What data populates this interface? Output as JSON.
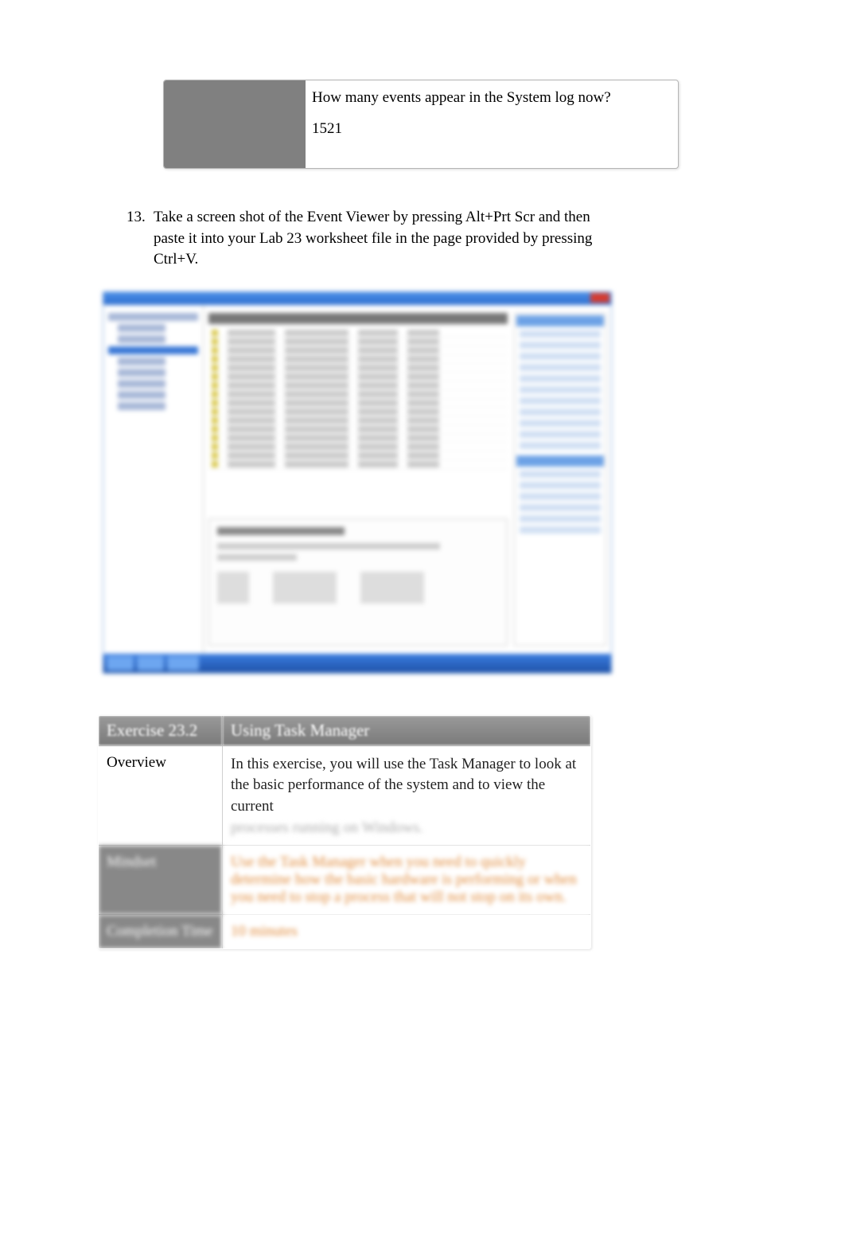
{
  "question_box": {
    "question": "How many events appear in the System log now?",
    "answer": "1521"
  },
  "step": {
    "number": "13.",
    "text_part1": "Take a screen shot of the Event Viewer by pressing ",
    "kbd1": "Alt+Prt Scr",
    "text_part2": " and then paste it into your Lab 23 worksheet file in the page provided by pressing Ctrl+V."
  },
  "exercise": {
    "header_label": "Exercise 23.2",
    "header_title": "Using Task Manager",
    "overview_label": "Overview",
    "overview_text": "In this exercise, you will use the Task Manager to look at the basic performance of the system and to view the current",
    "overview_blurred": "processes running on Windows.",
    "mindset_label": "Mindset",
    "mindset_text": "Use the Task Manager when you need to quickly determine how the basic hardware is performing or when you need to stop a process that will not stop on its own.",
    "time_label": "Completion Time",
    "time_value": "10 minutes"
  }
}
